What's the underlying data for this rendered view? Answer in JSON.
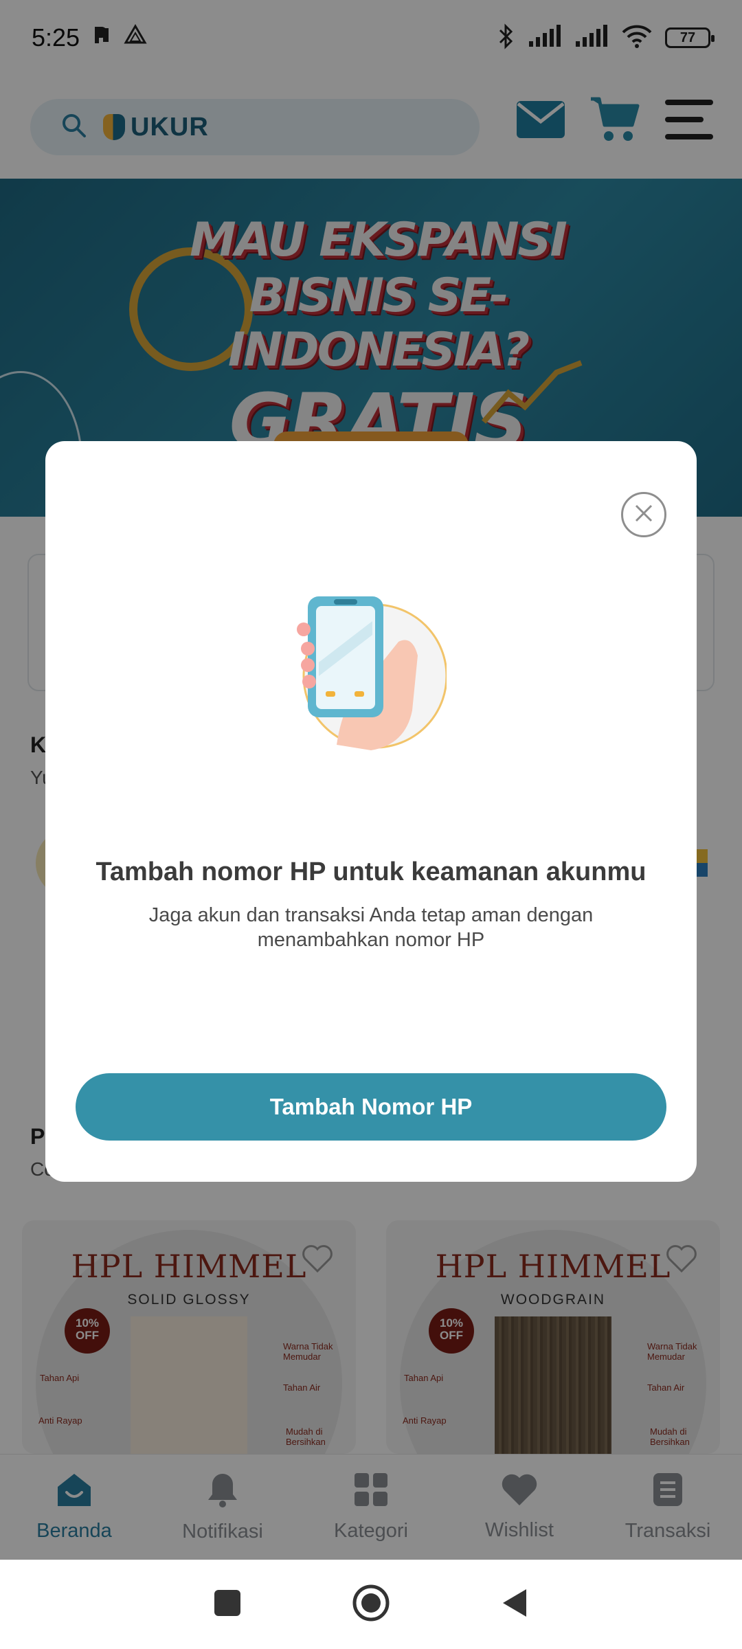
{
  "status_bar": {
    "time": "5:25",
    "battery": "77"
  },
  "header": {
    "brand": "UKUR"
  },
  "banner": {
    "line1": "MAU EKSPANSI",
    "line2": "BISNIS SE-INDONESIA?",
    "line3": "GRATIS"
  },
  "sections": [
    {
      "title": "K",
      "subtitle": "Yu"
    },
    {
      "title": "P",
      "subtitle": "Co"
    }
  ],
  "products": [
    {
      "title": "HPL HIMMEL",
      "subtitle": "SOLID GLOSSY",
      "badge": "10% OFF",
      "features": [
        "Warna Tidak Memudar",
        "Tahan Api",
        "Tahan Air",
        "Anti Rayap",
        "Mudah di Bersihkan"
      ]
    },
    {
      "title": "HPL HIMMEL",
      "subtitle": "WOODGRAIN",
      "badge": "10% OFF",
      "features": [
        "Warna Tidak Memudar",
        "Tahan Api",
        "Tahan Air",
        "Anti Rayap",
        "Mudah di Bersihkan"
      ]
    }
  ],
  "bottom_nav": {
    "items": [
      {
        "label": "Beranda",
        "icon": "home-icon",
        "active": true
      },
      {
        "label": "Notifikasi",
        "icon": "bell-icon"
      },
      {
        "label": "Kategori",
        "icon": "grid-icon"
      },
      {
        "label": "Wishlist",
        "icon": "heart-icon"
      },
      {
        "label": "Transaksi",
        "icon": "receipt-icon"
      }
    ]
  },
  "modal": {
    "title": "Tambah nomor HP untuk keamanan akunmu",
    "description": "Jaga akun dan transaksi Anda tetap aman dengan menambahkan nomor HP",
    "cta_label": "Tambah Nomor HP"
  },
  "colors": {
    "accent": "#3591a8",
    "brand_dark": "#1c5f7a",
    "active_nav": "#2b7ea0"
  }
}
